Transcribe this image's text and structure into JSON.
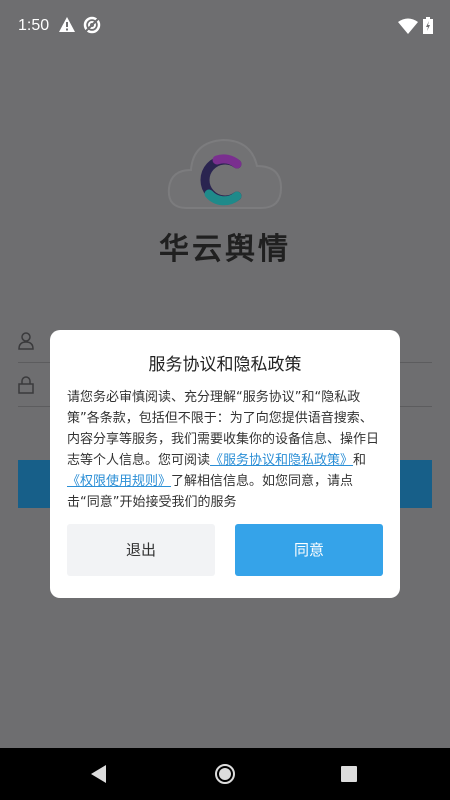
{
  "status_bar": {
    "time": "1:50",
    "icons": [
      "warning-icon",
      "sync-icon",
      "wifi-icon",
      "battery-icon"
    ]
  },
  "background": {
    "app_name": "华云舆情",
    "logo_letter": "C",
    "field_icons": [
      "user-icon",
      "lock-icon"
    ]
  },
  "dialog": {
    "title": "服务协议和隐私政策",
    "body_intro": "请您务必审慎阅读、充分理解“服务协议”和“隐私政策”各条款，包括但不限于：为了向您提供语音搜索、内容分享等服务，我们需要收集你的设备信息、操作日志等个人信息。您可阅读",
    "link_privacy": "《服务协议和隐私政策》",
    "body_and": "和",
    "link_permissions": "《权限使用规则》",
    "body_outro": "了解相信信息。如您同意，请点击“同意”开始接受我们的服务",
    "exit_label": "退出",
    "agree_label": "同意"
  },
  "colors": {
    "overlay": "#6e6e70",
    "agree_button": "#35a3e9",
    "link": "#2c8fd6",
    "background_button": "#175f89"
  },
  "nav_bar": {
    "icons": [
      "back-icon",
      "home-icon",
      "recents-icon"
    ]
  }
}
